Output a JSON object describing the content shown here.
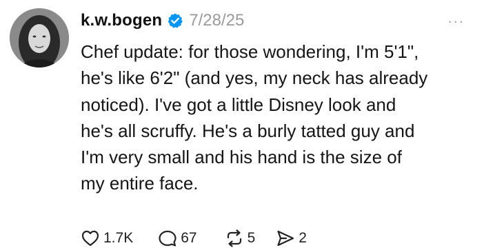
{
  "post": {
    "username": "k.w.bogen",
    "date": "7/28/25",
    "more_label": "...",
    "text": "Chef update: for those wondering, I'm 5'1\",\nhe's like 6'2\" (and yes, my neck has already\nnoticed). I've got a little Disney look and\nhe's all scruffy. He's a burly tatted guy and\nI'm very small and his hand is the size of\nmy entire face.",
    "verified_color": "#0095f6",
    "actions": {
      "like_count": "1.7K",
      "reply_count": "67",
      "repost_count": "5",
      "share_count": "2"
    },
    "icons": {
      "like": "heart-icon",
      "reply": "comment-bubble-icon",
      "repost": "repost-icon",
      "share": "send-icon",
      "verified": "verified-badge-icon"
    }
  }
}
